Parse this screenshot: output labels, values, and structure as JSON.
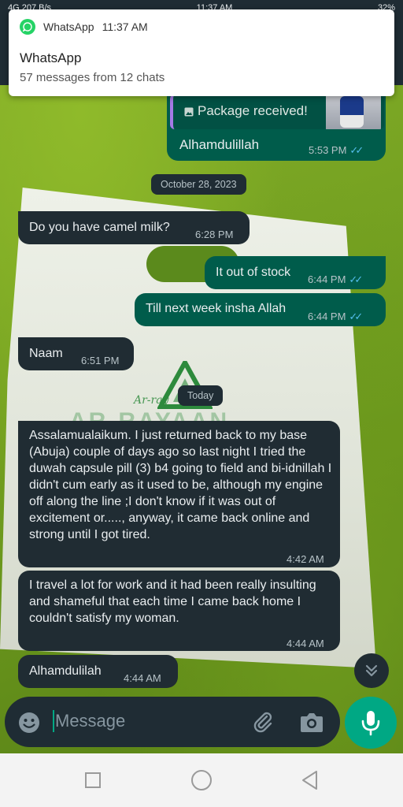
{
  "status_bar": {
    "left": "4G 207 B/s",
    "time": "11:37 AM",
    "battery": "32%"
  },
  "notification": {
    "app": "WhatsApp",
    "time": "11:37 AM",
    "title": "WhatsApp",
    "body": "57 messages from 12 chats"
  },
  "quoted": {
    "text": "Package received!",
    "icon": "image-icon"
  },
  "messages": [
    {
      "id": "m1",
      "dir": "out",
      "text": "Alhamdulillah",
      "time": "5:53 PM",
      "read": true
    },
    {
      "id": "m2",
      "dir": "in",
      "text": "Do you have camel milk?",
      "time": "6:28 PM"
    },
    {
      "id": "m3",
      "dir": "out",
      "text": "It out of stock",
      "time": "6:44 PM",
      "read": true
    },
    {
      "id": "m4",
      "dir": "out",
      "text": "Till next week insha Allah",
      "time": "6:44 PM",
      "read": true
    },
    {
      "id": "m5",
      "dir": "in",
      "text": "Naam",
      "time": "6:51 PM"
    },
    {
      "id": "m6",
      "dir": "in",
      "text": "Assalamualaikum. I just returned back to my base (Abuja) couple of days ago so last night I tried the duwah capsule pill (3) b4 going to field and bi-idnillah I didn't cum early as it used to be, although my engine off along the line ;I don't know if it was out of excitement or....., anyway, it came back online and strong until I got tired.",
      "time": "4:42 AM"
    },
    {
      "id": "m7",
      "dir": "in",
      "text": "I travel a lot for work and it had been really insulting and shameful that each time I came back home I couldn't satisfy my woman.",
      "time": "4:44 AM"
    },
    {
      "id": "m8",
      "dir": "in",
      "text": "Alhamdulilah",
      "time": "4:44 AM"
    }
  ],
  "dates": {
    "d1": "October 28, 2023",
    "d2": "Today"
  },
  "composer": {
    "placeholder": "Message"
  },
  "wallpaper": {
    "bag_logo_text": "Ar-ray",
    "bag_big_text": "AR-RAYAAN"
  },
  "colors": {
    "incoming_bubble": "#202c33",
    "outgoing_bubble": "#005c4b",
    "accent": "#00a884",
    "read_ticks": "#53bdeb"
  }
}
